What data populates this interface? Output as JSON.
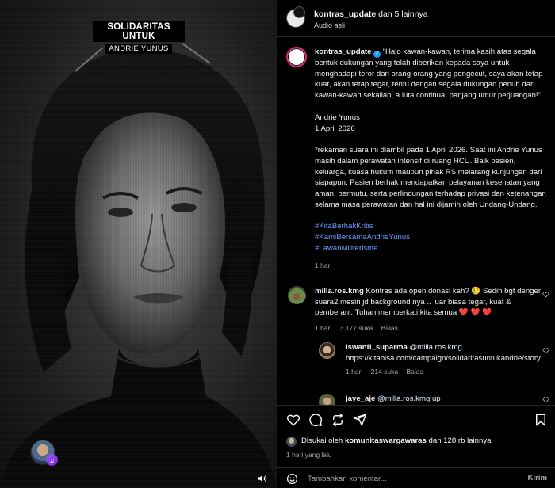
{
  "media": {
    "overlay_title": "SOLIDARITAS UNTUK",
    "overlay_subtitle": "ANDRIE YUNUS"
  },
  "header": {
    "username": "kontras_update",
    "coauthors": "dan 5 lainnya",
    "audio": "Audio asli"
  },
  "caption": {
    "username": "kontras_update",
    "text_1": "“Halo kawan-kawan, terima kasih atas segala bentuk dukungan yang telah diberikan kepada saya untuk menghadapi teror dari orang-orang yang pengecut, saya akan tetap kuat, akan tetap tegar, tentu dengan segala dukungan penuh dari kawan-kawan sekalian, a luta continua! panjang umur perjuangan!”",
    "sign_name": "Andrie Yunus",
    "sign_date": "1 April 2026",
    "text_2": "*rekaman suara ini diambil pada 1 April 2026. Saat ini Andrie Yunus masih dalam perawatan intensif di ruang HCU. Baik pasien, keluarga, kuasa hukum maupun pihak RS melarang kunjungan dari siapapun. Pasien berhak mendapatkan pelayanan kesehatan yang aman, bermutu, serta perlindungan terhadap privasi dan ketenangan selama masa perawatan dan hal ini dijamin oleh Undang-Undang.",
    "hashtags": [
      "#KitaBerhakKritis",
      "#KamiBersamaAndrieYunus",
      "#LawanMiliterisme"
    ],
    "time": "1 hari"
  },
  "comments": [
    {
      "username": "milla.ros.kmg",
      "text": "Kontras ada open donasi kah? 😢 Sedih bgt denger suara2 mesin jd background nya .. luar biasa tegar, kuat & pemberani. Tuhan memberkati kita semua ❤️ ❤️ ❤️",
      "time": "1 hari",
      "likes": "3.177 suka",
      "reply": "Balas"
    },
    {
      "username": "iswanti_suparma",
      "mention": "@milla.ros.kmg",
      "text": "https://kitabisa.com/campaign/solidaritasuntukandrie/story",
      "time": "1 hari",
      "likes": "214 suka",
      "reply": "Balas"
    },
    {
      "username": "jaye_aje",
      "mention": "@milla.ros.kmg",
      "text": "up"
    }
  ],
  "likes": {
    "liked_by_prefix": "Disukai oleh",
    "liked_by_user": "komunitaswargawaras",
    "liked_by_rest": "dan 128 rb lainnya",
    "time": "1 hari yang lalu"
  },
  "add_comment": {
    "placeholder": "Tambahkan komentar...",
    "post_label": "Kirim"
  },
  "icons": {
    "like": "heart-icon",
    "comment": "comment-icon",
    "share": "repost-icon",
    "send": "send-icon",
    "save": "bookmark-icon",
    "emoji": "emoji-icon",
    "mute": "speaker-icon",
    "music": "music-icon",
    "verified": "verified-badge-icon"
  }
}
